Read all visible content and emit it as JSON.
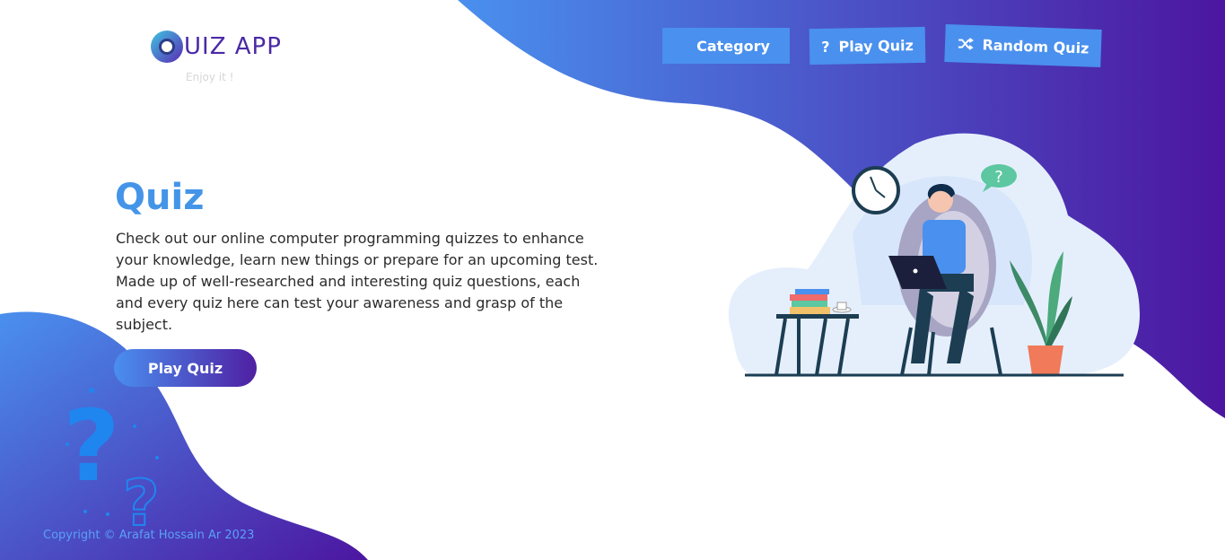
{
  "logo": {
    "text": "UIZ APP",
    "subtitle": "Enjoy it !"
  },
  "nav": {
    "category_label": "Category",
    "play_quiz_label": "Play Quiz",
    "random_quiz_label": "Random Quiz"
  },
  "hero": {
    "title": "Quiz",
    "description": "Check out our online computer programming quizzes to enhance your knowledge, learn new things or prepare for an upcoming test. Made up of well-researched and interesting quiz questions, each and every quiz here can test your awareness and grasp of the subject.",
    "button_label": "Play Quiz"
  },
  "illustration": {
    "speech_bubble": "?"
  },
  "footer": {
    "copyright": "Copyright © Arafat Hossain Ar 2023"
  },
  "colors": {
    "accent": "#4495e8",
    "gradient_start": "#4a8ff0",
    "gradient_end": "#4f1fa2",
    "nav_button": "#4a90ee"
  }
}
